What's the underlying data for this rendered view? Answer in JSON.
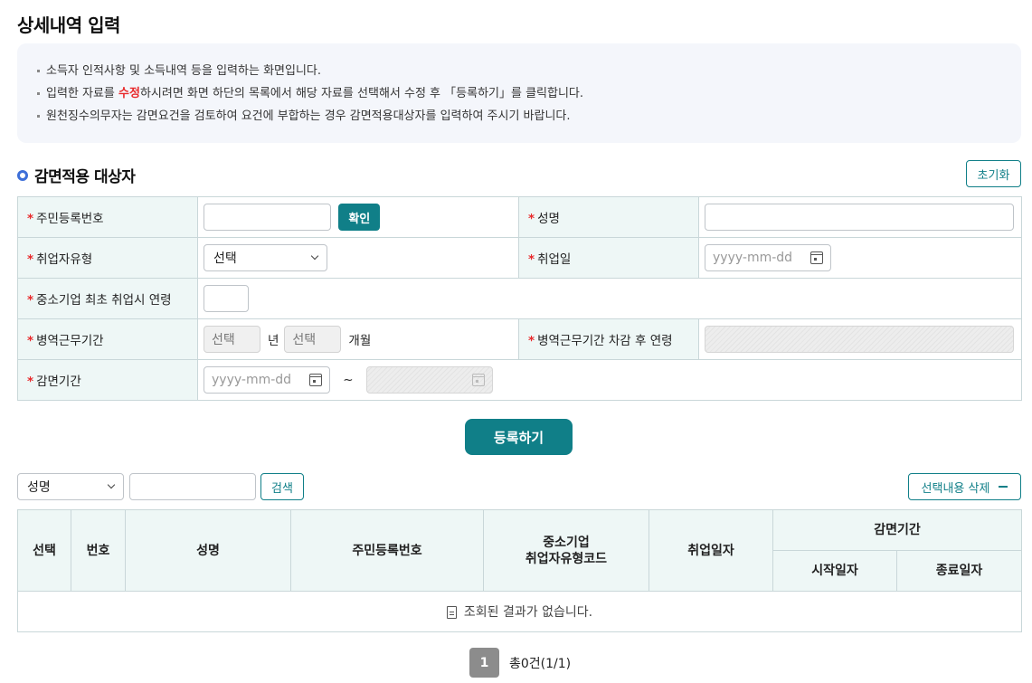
{
  "page_title": "상세내역 입력",
  "notice": {
    "line1": "소득자 인적사항 및 소득내역 등을 입력하는 화면입니다.",
    "line2_prefix": "입력한 자료를 ",
    "line2_highlight": "수정",
    "line2_suffix": "하시려면 화면 하단의 목록에서 해당 자료를 선택해서 수정 후 「등록하기」를 클릭합니다.",
    "line3": "원천징수의무자는 감면요건을 검토하여 요건에 부합하는 경우 감면적용대상자를 입력하여 주시기 바랍니다."
  },
  "section": {
    "title": "감면적용 대상자",
    "reset_label": "초기화"
  },
  "form": {
    "required_mark": "*",
    "resident_no_label": "주민등록번호",
    "confirm_label": "확인",
    "name_label": "성명",
    "employment_type_label": "취업자유형",
    "employment_type_value": "선택",
    "employment_date_label": "취업일",
    "date_placeholder": "yyyy-mm-dd",
    "first_employment_age_label": "중소기업 최초 취업시 연령",
    "military_period_label": "병역근무기간",
    "military_year_select": "선택",
    "year_unit": "년",
    "military_month_select": "선택",
    "month_unit": "개월",
    "age_after_military_label": "병역근무기간 차감 후 연령",
    "reduction_period_label": "감면기간",
    "range_separator": "~"
  },
  "register_label": "등록하기",
  "search": {
    "field_select": "성명",
    "search_label": "검색",
    "delete_label": "선택내용 삭제"
  },
  "list": {
    "columns": {
      "select": "선택",
      "number": "번호",
      "name": "성명",
      "resident_no": "주민등록번호",
      "sme_line1": "중소기업",
      "sme_line2": "취업자유형코드",
      "employment_date": "취업일자",
      "reduction_period": "감면기간",
      "start_date": "시작일자",
      "end_date": "종료일자"
    },
    "empty_message": "조회된 결과가 없습니다."
  },
  "pager": {
    "current_page": "1",
    "total": "총0건(1/1)"
  }
}
